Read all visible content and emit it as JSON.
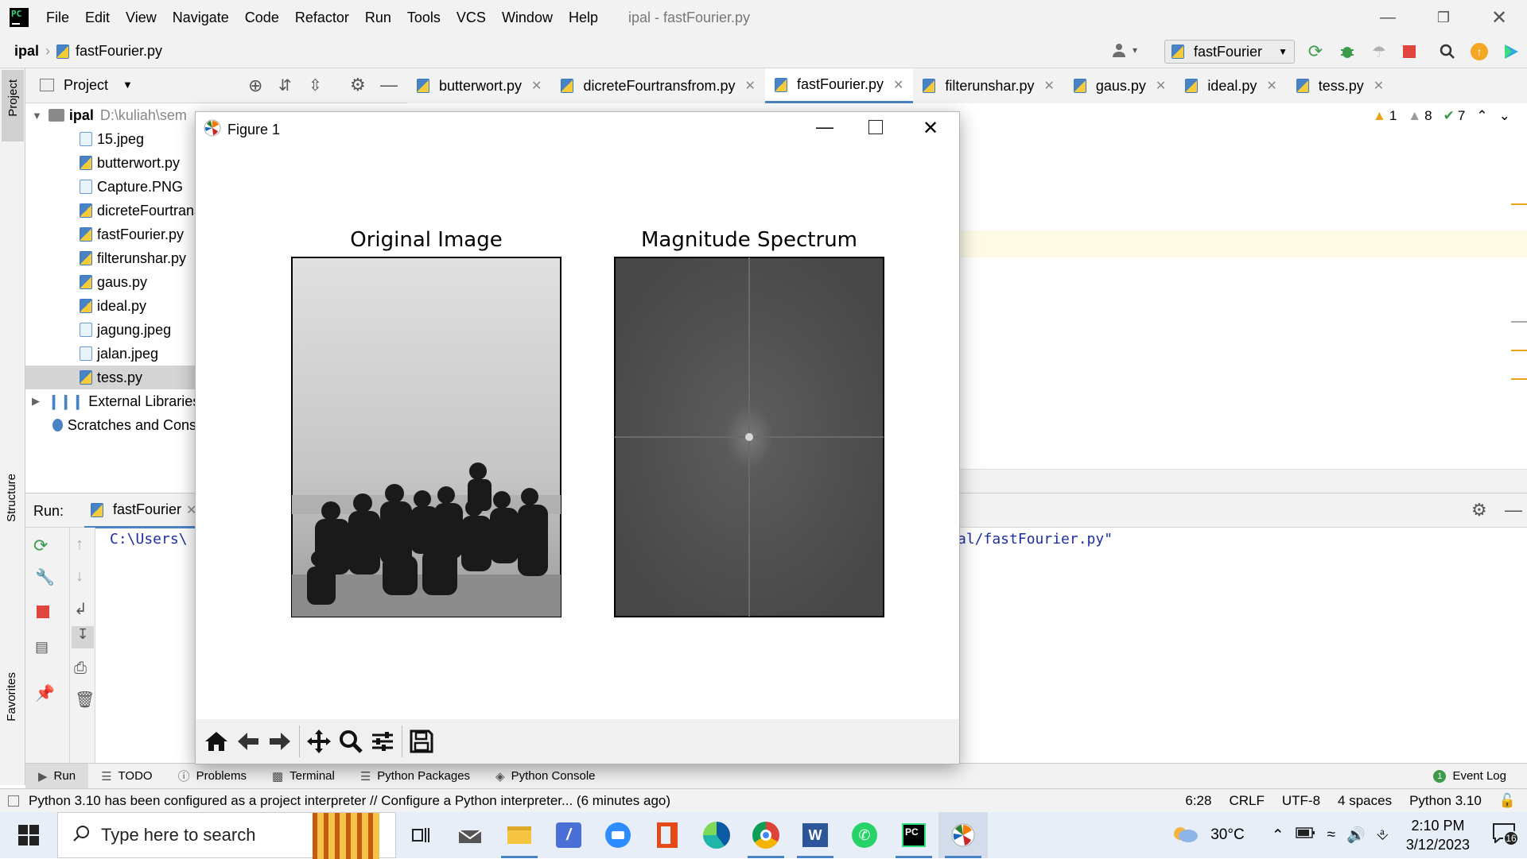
{
  "app": {
    "menu": [
      "File",
      "Edit",
      "View",
      "Navigate",
      "Code",
      "Refactor",
      "Run",
      "Tools",
      "VCS",
      "Window",
      "Help"
    ],
    "window_title": "ipal - fastFourier.py"
  },
  "navbar": {
    "project": "ipal",
    "file": "fastFourier.py",
    "run_config": "fastFourier"
  },
  "project_panel": {
    "header": "Project",
    "root_name": "ipal",
    "root_path": "D:\\kuliah\\sem",
    "files": [
      "15.jpeg",
      "butterwort.py",
      "Capture.PNG",
      "dicreteFourtrans",
      "fastFourier.py",
      "filterunshar.py",
      "gaus.py",
      "ideal.py",
      "jagung.jpeg",
      "jalan.jpeg",
      "tess.py"
    ],
    "external": "External Libraries",
    "scratches": "Scratches and Cons"
  },
  "side_labels": {
    "project": "Project",
    "structure": "Structure",
    "favorites": "Favorites"
  },
  "tabs": [
    "butterwort.py",
    "dicreteFourtransfrom.py",
    "fastFourier.py",
    "filterunshar.py",
    "gaus.py",
    "ideal.py",
    "tess.py"
  ],
  "active_tab": "fastFourier.py",
  "inspections": {
    "warnings": "1",
    "weak_warnings": "8",
    "typos": "7"
  },
  "run_panel": {
    "label": "Run:",
    "tab": "fastFourier",
    "console_left": "C:\\Users\\",
    "console_right": "al/fastFourier.py\""
  },
  "bottom_tabs": [
    "Run",
    "TODO",
    "Problems",
    "Terminal",
    "Python Packages",
    "Python Console"
  ],
  "event_log": "Event Log",
  "status": {
    "message": "Python 3.10 has been configured as a project interpreter // Configure a Python interpreter... (6 minutes ago)",
    "position": "6:28",
    "line_sep": "CRLF",
    "encoding": "UTF-8",
    "indent": "4 spaces",
    "interpreter": "Python 3.10"
  },
  "figure": {
    "title": "Figure 1",
    "left_title": "Original Image",
    "right_title": "Magnitude Spectrum"
  },
  "taskbar": {
    "search_placeholder": "Type here to search",
    "weather": "30°C",
    "time": "2:10 PM",
    "date": "3/12/2023",
    "notifications": "16"
  },
  "colors": {
    "accent": "#4a83c4",
    "run_green": "#3c9a4b",
    "stop_red": "#e0443e"
  }
}
